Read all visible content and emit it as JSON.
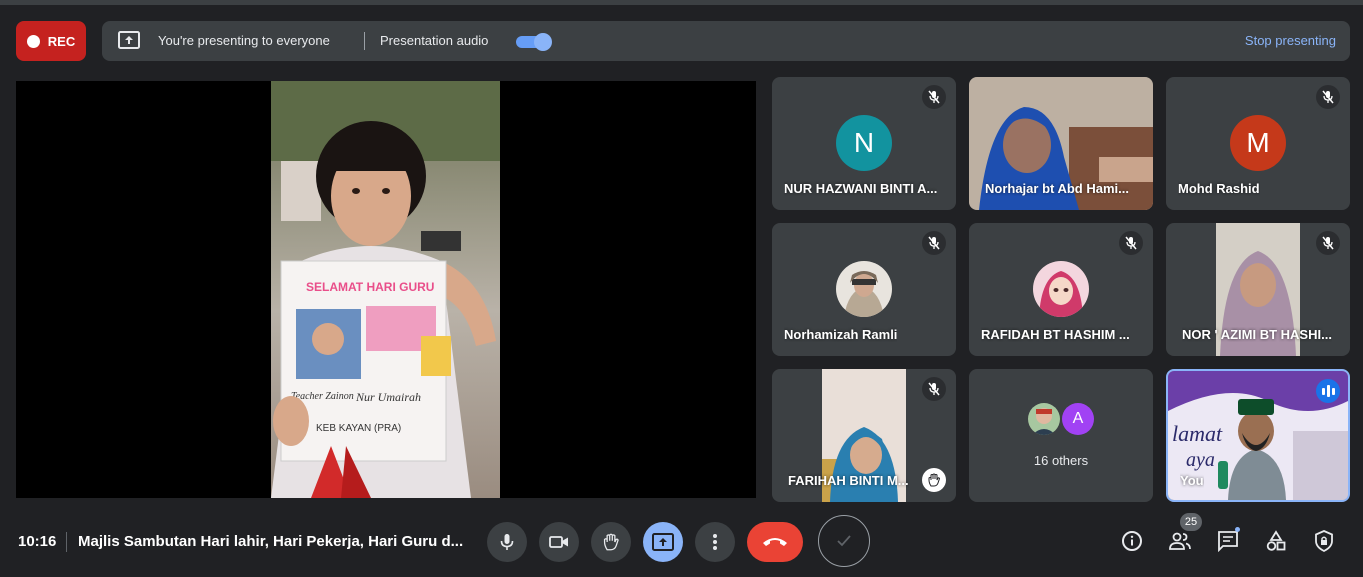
{
  "recording": {
    "label": "REC",
    "color": "#c5221f"
  },
  "presenting_bar": {
    "status_text": "You're presenting to everyone",
    "audio_label": "Presentation audio",
    "audio_toggle_on": true,
    "stop_label": "Stop presenting"
  },
  "participants": [
    {
      "name": "NUR HAZWANI BINTI A...",
      "avatar_letter": "N",
      "avatar_color": "#12939f",
      "muted": true
    },
    {
      "name": "Norhajar bt Abd Hami...",
      "video": true,
      "muted": false
    },
    {
      "name": "Mohd Rashid",
      "avatar_letter": "M",
      "avatar_color": "#c5391a",
      "muted": true
    },
    {
      "name": "Norhamizah Ramli",
      "avatar_photo": true,
      "muted": true
    },
    {
      "name": "RAFIDAH BT HASHIM ...",
      "avatar_photo": true,
      "muted": true
    },
    {
      "name": "NOR ' AZIMI BT HASHI...",
      "video": true,
      "muted": true
    },
    {
      "name": "FARIHAH BINTI M...",
      "video": true,
      "muted": true,
      "hand_raised": true
    },
    {
      "others_label": "16 others",
      "avatar_letter": "A",
      "avatar_color": "#a142f4"
    },
    {
      "name": "You",
      "video": true,
      "speaking": true
    }
  ],
  "bottom_bar": {
    "time": "10:16",
    "meeting_title": "Majlis Sambutan Hari lahir, Hari Pekerja, Hari Guru d...",
    "participants_count": "25"
  },
  "icons": {
    "mic": "mic-icon",
    "camera": "camera-icon",
    "hand": "raise-hand-icon",
    "present": "present-icon",
    "more": "more-options-icon",
    "hangup": "hangup-icon",
    "info": "info-icon",
    "people": "people-icon",
    "chat": "chat-icon",
    "activities": "activities-icon",
    "host": "host-controls-icon"
  }
}
